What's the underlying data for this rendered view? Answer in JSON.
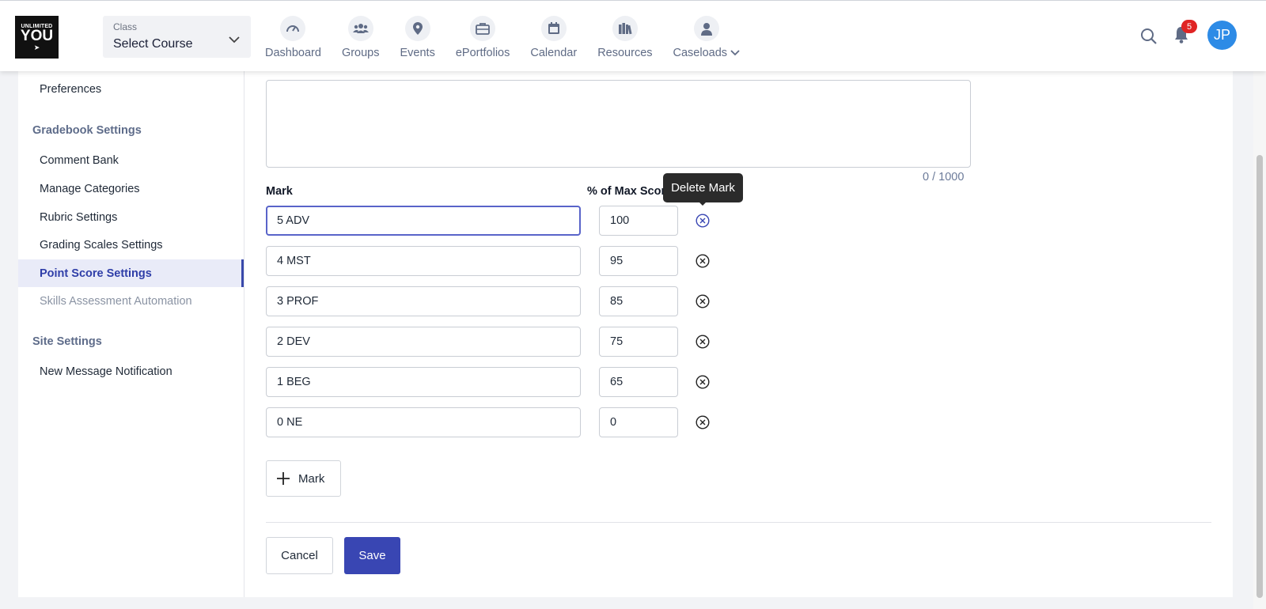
{
  "header": {
    "logo": {
      "line1": "UNLIMITED",
      "line2": "YOU"
    },
    "course_select": {
      "label": "Class",
      "value": "Select Course"
    },
    "nav": [
      {
        "label": "Dashboard",
        "icon": "gauge-icon"
      },
      {
        "label": "Groups",
        "icon": "people-icon"
      },
      {
        "label": "Events",
        "icon": "map-pin-icon"
      },
      {
        "label": "ePortfolios",
        "icon": "briefcase-icon"
      },
      {
        "label": "Calendar",
        "icon": "calendar-icon"
      },
      {
        "label": "Resources",
        "icon": "books-icon"
      },
      {
        "label": "Caseloads",
        "icon": "person-icon"
      }
    ],
    "notification_count": "5",
    "avatar_initials": "JP"
  },
  "sidebar": {
    "top_item": "Preferences",
    "gradebook_heading": "Gradebook Settings",
    "gradebook_items": [
      "Comment Bank",
      "Manage Categories",
      "Rubric Settings",
      "Grading Scales Settings",
      "Point Score Settings",
      "Skills Assessment Automation"
    ],
    "active_item": "Point Score Settings",
    "site_heading": "Site Settings",
    "site_items": [
      "New Message Notification"
    ]
  },
  "form": {
    "char_counter": "0 / 1000",
    "mark_column_label": "Mark",
    "percent_column_label": "% of Max Score",
    "marks": [
      {
        "mark": "5 ADV",
        "percent": "100"
      },
      {
        "mark": "4 MST",
        "percent": "95"
      },
      {
        "mark": "3 PROF",
        "percent": "85"
      },
      {
        "mark": "2 DEV",
        "percent": "75"
      },
      {
        "mark": "1 BEG",
        "percent": "65"
      },
      {
        "mark": "0 NE",
        "percent": "0"
      }
    ],
    "tooltip": "Delete Mark",
    "add_mark_label": "Mark",
    "cancel_label": "Cancel",
    "save_label": "Save"
  },
  "colors": {
    "primary": "#3946b3",
    "active_sidebar_bg": "#e9ebf8",
    "badge": "#e02424",
    "avatar": "#2d8be6"
  }
}
